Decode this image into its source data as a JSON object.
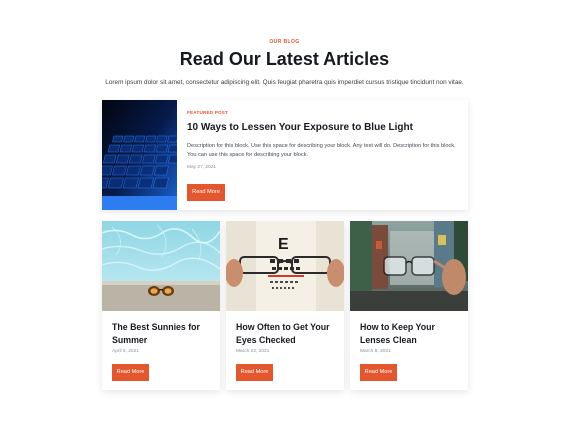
{
  "section": {
    "eyebrow": "OUR BLOG",
    "heading": "Read Our Latest Articles",
    "intro": "Lorem ipsum dolor sit amet, consectetur adipiscing elit. Quis feugiat pharetra quis imperdiet cursus tristique tincidunt non vitae."
  },
  "featured": {
    "tag": "FEATURED POST",
    "title": "10 Ways to Lessen Your Exposure to Blue Light",
    "description": "Description for this block. Use this space for describing your block. Any text will do. Description for this block. You can use this space for describing your block.",
    "date": "May 27, 2021",
    "button_label": "Read More",
    "image_icon": "keyboard-photo"
  },
  "posts": [
    {
      "title": "The Best Sunnies for Summer",
      "date": "April 5, 2021",
      "button_label": "Read More",
      "image_icon": "pool-sunglasses-photo"
    },
    {
      "title": "How Often to Get Your Eyes Checked",
      "date": "March 22, 2021",
      "button_label": "Read More",
      "image_icon": "eye-chart-glasses-photo"
    },
    {
      "title": "How to Keep Your Lenses Clean",
      "date": "March 8, 2021",
      "button_label": "Read More",
      "image_icon": "street-glasses-photo"
    }
  ],
  "colors": {
    "accent": "#e4572e",
    "heading": "#16191f",
    "muted": "#8a8f96"
  }
}
